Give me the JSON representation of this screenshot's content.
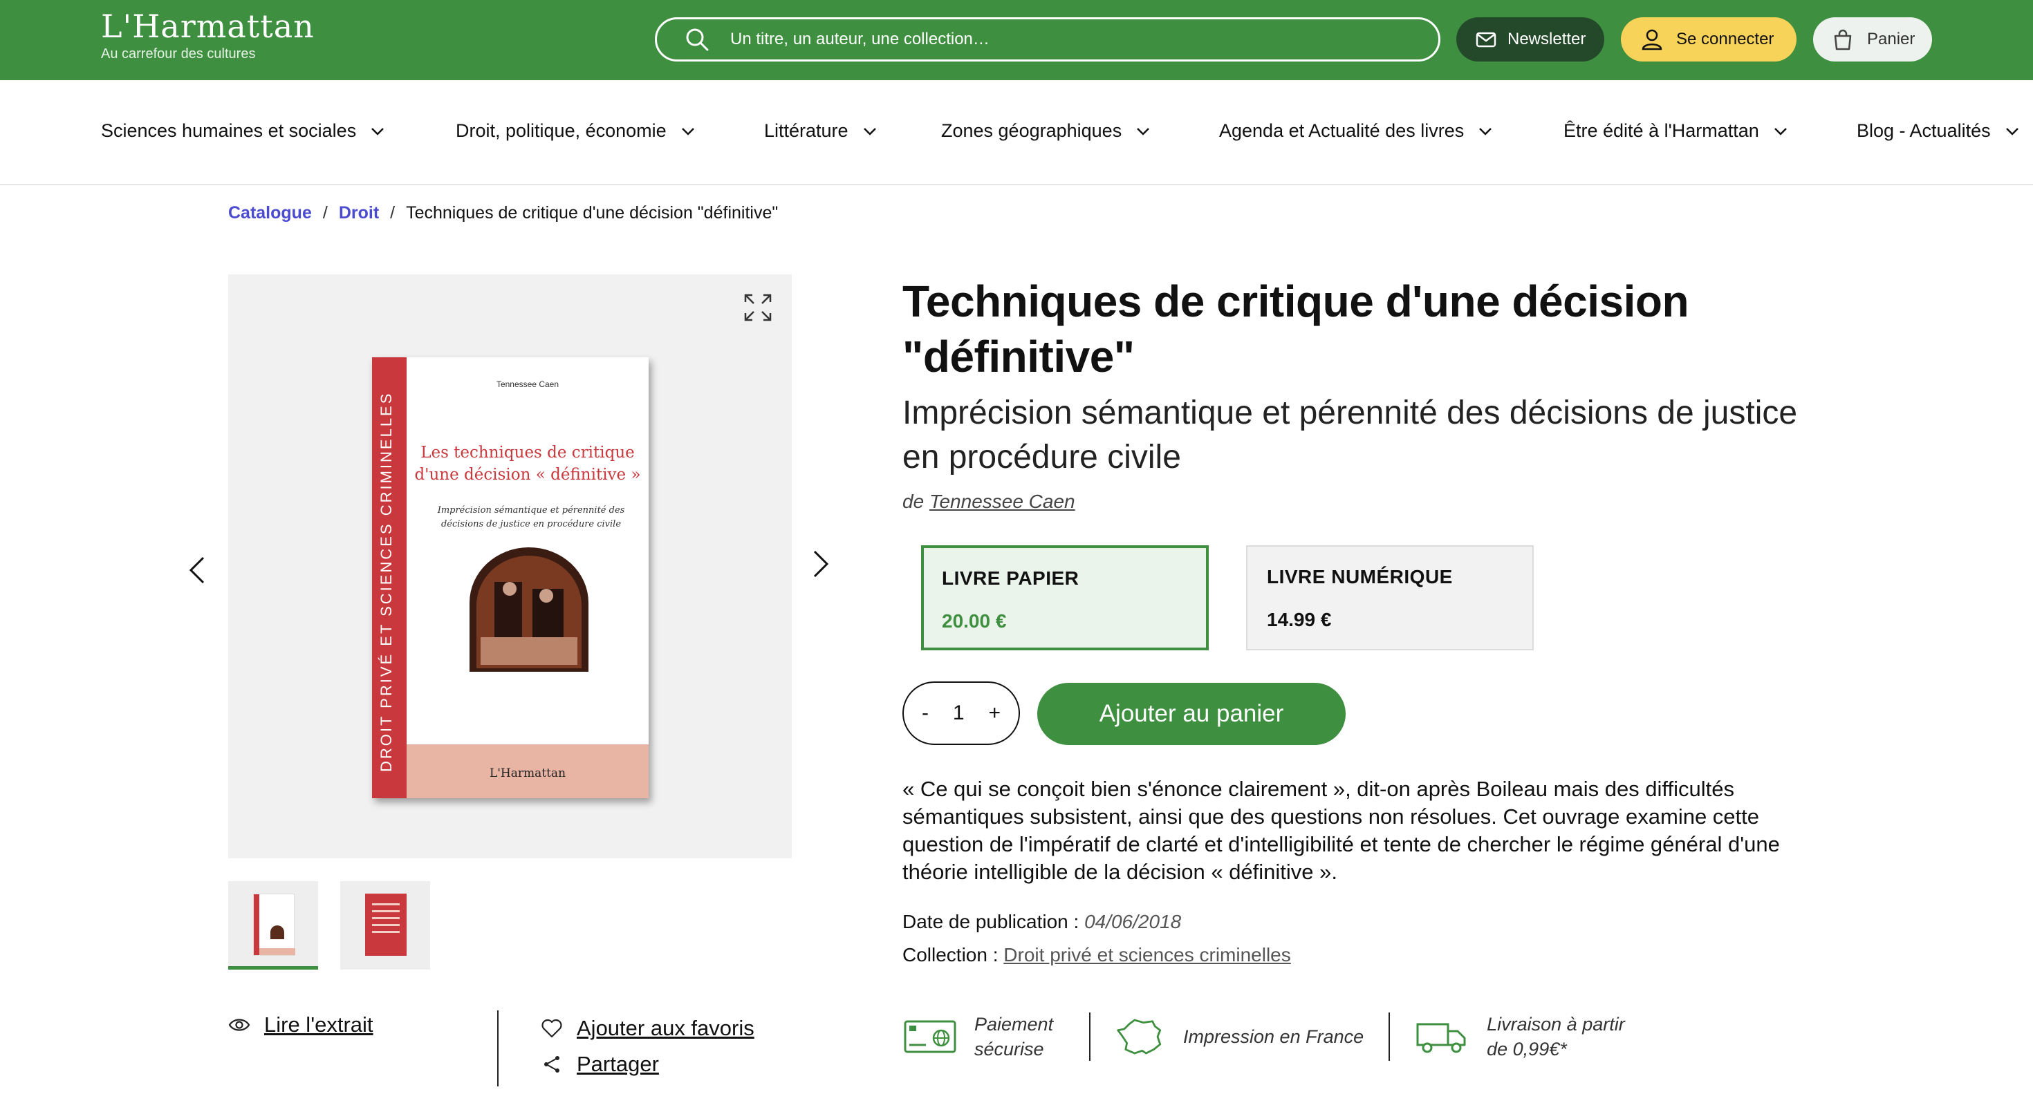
{
  "brand": {
    "name": "L'Harmattan",
    "tagline": "Au carrefour des cultures",
    "color": "#3f8f40"
  },
  "header": {
    "search_placeholder": "Un titre, un auteur, une collection…",
    "newsletter_label": "Newsletter",
    "login_label": "Se connecter",
    "cart_label": "Panier"
  },
  "nav": {
    "items": [
      {
        "label": "Sciences humaines et sociales"
      },
      {
        "label": "Droit, politique, économie"
      },
      {
        "label": "Littérature"
      },
      {
        "label": "Zones géographiques"
      },
      {
        "label": "Agenda et Actualité des livres"
      },
      {
        "label": "Être édité à l'Harmattan"
      },
      {
        "label": "Blog - Actualités"
      }
    ]
  },
  "breadcrumb": {
    "items": [
      "Catalogue",
      "Droit"
    ],
    "current": "Techniques de critique d'une décision \"définitive\""
  },
  "cover": {
    "spine": "DROIT PRIVÉ ET SCIENCES CRIMINELLES",
    "author": "Tennessee Caen",
    "title": "Les techniques de critique d'une décision « définitive »",
    "subtitle": "Imprécision sémantique et pérennité des décisions de justice en procédure civile",
    "publisher": "L'Harmattan"
  },
  "gallery": {
    "extract_label": "Lire l'extrait",
    "favorites_label": "Ajouter aux favoris",
    "share_label": "Partager"
  },
  "product": {
    "title": "Techniques de critique d'une décision \"définitive\"",
    "subtitle": "Imprécision sémantique et pérennité des décisions de justice en procédure civile",
    "author_prefix": "de",
    "author": "Tennessee Caen",
    "formats": [
      {
        "label": "LIVRE PAPIER",
        "price": "20.00 €",
        "selected": true
      },
      {
        "label": "LIVRE NUMÉRIQUE",
        "price": "14.99 €",
        "selected": false
      }
    ],
    "quantity": "1",
    "qty_minus": "-",
    "qty_plus": "+",
    "add_to_cart": "Ajouter au panier",
    "description": "« Ce qui se conçoit bien s'énonce clairement », dit-on après Boileau mais des difficultés sémantiques subsistent, ainsi que des questions non résolues. Cet ouvrage examine cette question de l'impératif de clarté et d'intelligibilité et tente de chercher le régime général d'une théorie intelligible de la décision « définitive ».",
    "date_label": "Date de publication :",
    "date_value": "04/06/2018",
    "collection_label": "Collection :",
    "collection_value": "Droit privé et sciences criminelles"
  },
  "features": [
    {
      "icon": "secure-payment-icon",
      "text": "Paiement sécurise"
    },
    {
      "icon": "france-map-icon",
      "text": "Impression en France"
    },
    {
      "icon": "delivery-truck-icon",
      "text": "Livraison à partir de 0,99€*"
    }
  ]
}
